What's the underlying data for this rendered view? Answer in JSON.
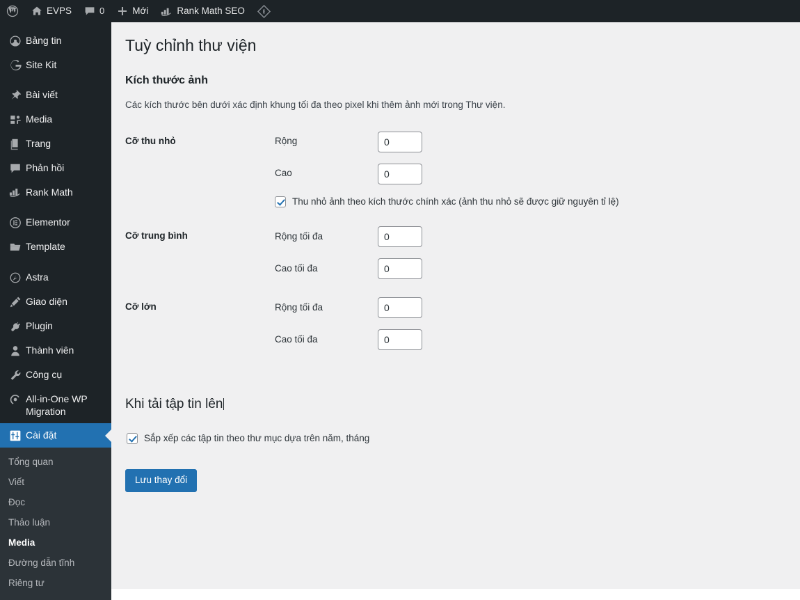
{
  "adminbar": {
    "items": [
      {
        "icon": "wordpress-logo-icon",
        "label": ""
      },
      {
        "icon": "home-icon",
        "label": "EVPS"
      },
      {
        "icon": "comment-icon",
        "label": "0"
      },
      {
        "icon": "plus-icon",
        "label": "Mới"
      },
      {
        "icon": "rank-math-icon",
        "label": "Rank Math SEO"
      },
      {
        "icon": "elementor-diamond-icon",
        "label": ""
      }
    ]
  },
  "sidebar": {
    "groups": [
      {
        "items": [
          {
            "label": "Bảng tin",
            "icon": "dashboard-icon"
          },
          {
            "label": "Site Kit",
            "icon": "google-g-icon"
          }
        ]
      },
      {
        "items": [
          {
            "label": "Bài viết",
            "icon": "pin-icon"
          },
          {
            "label": "Media",
            "icon": "media-icon"
          },
          {
            "label": "Trang",
            "icon": "page-icon"
          },
          {
            "label": "Phản hồi",
            "icon": "comment-icon"
          },
          {
            "label": "Rank Math",
            "icon": "rank-math-icon"
          }
        ]
      },
      {
        "items": [
          {
            "label": "Elementor",
            "icon": "elementor-icon"
          },
          {
            "label": "Template",
            "icon": "folder-icon"
          }
        ]
      },
      {
        "items": [
          {
            "label": "Astra",
            "icon": "astra-icon"
          },
          {
            "label": "Giao diện",
            "icon": "appearance-brush-icon"
          },
          {
            "label": "Plugin",
            "icon": "plug-icon"
          },
          {
            "label": "Thành viên",
            "icon": "user-icon"
          },
          {
            "label": "Công cụ",
            "icon": "wrench-icon"
          },
          {
            "label": "All-in-One WP Migration",
            "icon": "migration-icon"
          },
          {
            "label": "Cài đặt",
            "icon": "settings-sliders-icon",
            "current": true
          }
        ]
      }
    ],
    "submenu": [
      {
        "label": "Tổng quan"
      },
      {
        "label": "Viết"
      },
      {
        "label": "Đọc"
      },
      {
        "label": "Thảo luận"
      },
      {
        "label": "Media",
        "current": true
      },
      {
        "label": "Đường dẫn tĩnh"
      },
      {
        "label": "Riêng tư"
      }
    ]
  },
  "page": {
    "title": "Tuỳ chỉnh thư viện",
    "image_sizes_heading": "Kích thước ảnh",
    "image_sizes_description": "Các kích thước bên dưới xác định khung tối đa theo pixel khi thêm ảnh mới trong Thư viện.",
    "rows": [
      {
        "label": "Cỡ thu nhỏ",
        "fields": [
          {
            "label": "Rộng",
            "value": "0"
          },
          {
            "label": "Cao",
            "value": "0"
          }
        ],
        "checkbox": {
          "label": "Thu nhỏ ảnh theo kích thước chính xác (ảnh thu nhỏ sẽ được giữ nguyên tỉ lệ)",
          "checked": true
        }
      },
      {
        "label": "Cỡ trung bình",
        "fields": [
          {
            "label": "Rộng tối đa",
            "value": "0"
          },
          {
            "label": "Cao tối đa",
            "value": "0"
          }
        ]
      },
      {
        "label": "Cỡ lớn",
        "fields": [
          {
            "label": "Rộng tối đa",
            "value": "0"
          },
          {
            "label": "Cao tối đa",
            "value": "0"
          }
        ]
      }
    ],
    "upload_heading": "Khi tải tập tin lên",
    "upload_checkbox": {
      "label": "Sắp xếp các tập tin theo thư mục dựa trên năm, tháng",
      "checked": true
    },
    "save_button": "Lưu thay đổi"
  },
  "colors": {
    "accent": "#2271b1",
    "sidebar_bg": "#1d2327",
    "submenu_bg": "#2c3338",
    "content_bg": "#f0f0f1"
  }
}
